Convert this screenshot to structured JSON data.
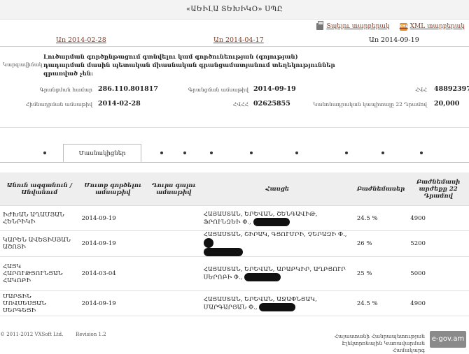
{
  "header": {
    "title": "«ԱԵԻԼԱ ՏԵԽԻԿՕ» ՍՊԸ"
  },
  "actions": {
    "print_label": "Տպելու տարբերակ",
    "xml_label": "XML տարբերակ"
  },
  "dates": [
    "Առ 2014-02-28",
    "Առ 2014-04-17",
    "Առ 2014-09-19"
  ],
  "activity": {
    "label": "Կարգավիճակ",
    "text": "Լուծարման գործընթացում գտնվելու կամ գործունեության (գոյության) դադարման մասին պետական միասնական գրանցամատյանում տեղեկություններ գրառված չեն:"
  },
  "fields": {
    "reg_number_label": "Գրանցման համար",
    "reg_number": "286.110.801817",
    "reg_date_label": "Գրանցման ամսաթիվ",
    "reg_date": "2014-09-19",
    "tin_label": "ՀՎՀ",
    "tin": "48892397",
    "founding_date_label": "Հիմնադրման ամսաթիվ",
    "founding_date": "2014-02-28",
    "hvhh_label": "ՀՎՀՀ",
    "hvhh": "02625855",
    "capital_label": "Կանոնադրական կապիտալը 22 Դրամով",
    "capital": "20,000"
  },
  "tabs": {
    "active": "Մասնակիցներ"
  },
  "table": {
    "headers": [
      "Անուն ազգանուն / Անվանում",
      "Մուտք գործելու ամսաթիվ",
      "Դուրս գալու ամսաթիվ",
      "Հասցե",
      "Բաժնեմասեր",
      "Բաժնեմասի արժեքը 22 Դրամով"
    ],
    "rows": [
      {
        "name": "ԻԺԽԱՆ ԱՂԱՄՅԱՆ ՀԵՆՐԻԿԻ",
        "in": "2014-09-19",
        "out": "",
        "addr": "ՀԱՅԱՍՏԱՆ, ԵՐԵՎԱՆ, ՇԵՆԳԱՎԻԹ, ՖՐՈՒՆԶԵԻ Փ.,",
        "share": "24.5 %",
        "value": "4900"
      },
      {
        "name": "ԿԱՐԵՆ ԱՎԵՏԻՍՅԱՆ ԱՇՈՏԻ",
        "in": "2014-09-19",
        "out": "",
        "addr": "ՀԱՅԱՍՏԱՆ, ՇԻՐԱԿ, ԳՅՈՒՄՐԻ, ՉԵՐԱԶԻ Փ.,",
        "share": "26 %",
        "value": "5200"
      },
      {
        "name": "ՀԱՅԿ ՀԱՐՈՒԹՅՈՒՆՅԱՆ ՀԱԿՈԲԻ",
        "in": "2014-03-04",
        "out": "",
        "addr": "ՀԱՅԱՍՏԱՆ, ԵՐԵՎԱՆ, ԱՐԱԲԿԻՐ, ԱՂԲՅՈՒՐ ՍԵՐՈԲԻ Փ.,",
        "share": "25 %",
        "value": "5000"
      },
      {
        "name": "ՄԱՐՏԻՆ ՄՈՎՍԵՍՅԱՆ ՍԵՐԳԵՅԻ",
        "in": "2014-09-19",
        "out": "",
        "addr": "ՀԱՅԱՍՏԱՆ, ԵՐԵՎԱՆ, ԱՋԱՓՆՅԱԿ, ՄԱՐԳԱՐՅԱՆ Փ.,",
        "share": "24.5 %",
        "value": "4900"
      }
    ]
  },
  "footer": {
    "copyright": "© 2011-2012 VXSoft Ltd.",
    "revision": "Revision 1.2",
    "gov_line1": "Հայաստանի Հանրապետության",
    "gov_line2": "Էլեկտրոնային Կառավարման Համակարգ",
    "badge": "e-gov.am"
  }
}
